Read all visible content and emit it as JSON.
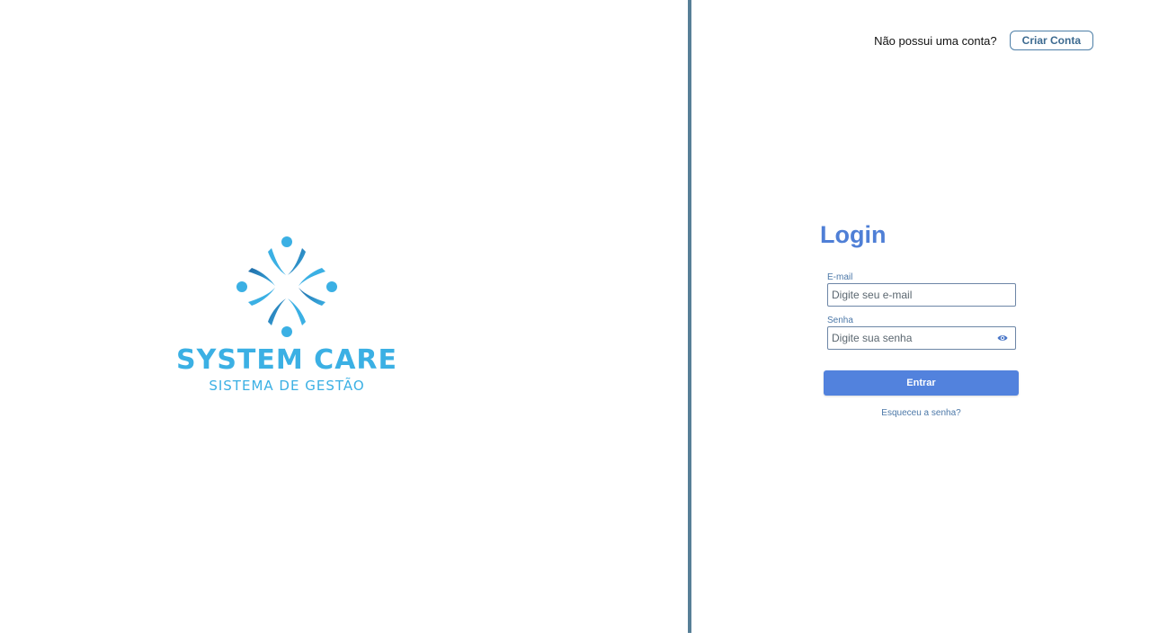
{
  "brand": {
    "name": "SYSTEM CARE",
    "tagline": "SISTEMA DE GESTÃO",
    "logo_icon": "people-circle-logo",
    "colors": {
      "primary": "#3bb0e4",
      "dark": "#1f6aa6"
    }
  },
  "header": {
    "signup_prompt": "Não possui uma conta?",
    "signup_button": "Criar Conta"
  },
  "login": {
    "title": "Login",
    "email": {
      "label": "E-mail",
      "placeholder": "Digite seu e-mail",
      "value": ""
    },
    "password": {
      "label": "Senha",
      "placeholder": "Digite sua senha",
      "value": "",
      "toggle_icon": "eye-icon"
    },
    "submit_label": "Entrar",
    "forgot_label": "Esqueceu a senha?"
  },
  "colors": {
    "accent": "#5282dd",
    "divider": "#577f97",
    "title": "#4f7fd6"
  }
}
